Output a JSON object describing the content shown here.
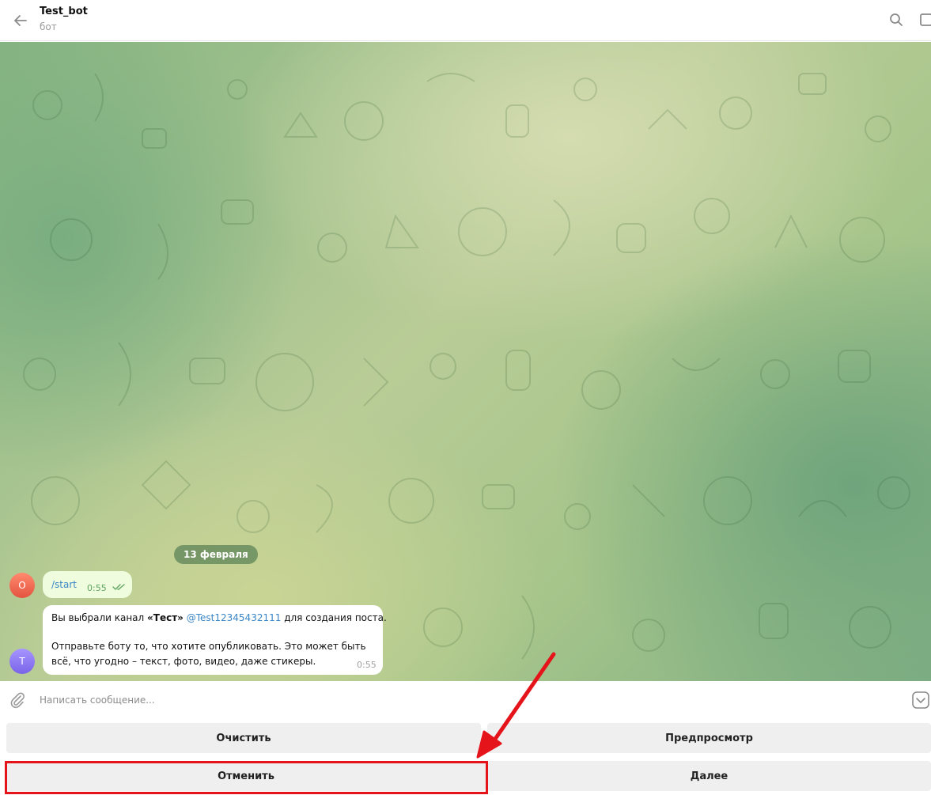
{
  "header": {
    "title": "Test_bot",
    "subtitle": "бот"
  },
  "icons": {
    "back": "arrow-left-icon",
    "search": "search-icon",
    "more": "sidebar-toggle-icon",
    "attach": "paperclip-icon",
    "keyboard": "bot-keyboard-icon"
  },
  "chat": {
    "date_label": "13 февраля",
    "messages": [
      {
        "direction": "outgoing",
        "avatar_letter": "O",
        "text": "/start",
        "time": "0:55",
        "status": "read"
      },
      {
        "direction": "incoming",
        "avatar_letter": "T",
        "line1_prefix": "Вы выбрали канал ",
        "line1_channel": "«Тест»",
        "line1_mention": "@Test12345432111",
        "line1_suffix": " для создания поста.",
        "line2": "Отправьте боту то, что хотите опубликовать. Это может быть",
        "line3": "всё, что угодно – текст, фото, видео, даже стикеры.",
        "time": "0:55"
      }
    ]
  },
  "composer": {
    "placeholder": "Написать сообщение...",
    "value": ""
  },
  "keyboard": {
    "clear": "Очистить",
    "preview": "Предпросмотр",
    "cancel": "Отменить",
    "next": "Далее"
  },
  "colors": {
    "accent": "#3a86c6",
    "outgoing_bubble": "#effdde",
    "annotation_red": "#e5141b",
    "button_bg": "#efefef"
  }
}
